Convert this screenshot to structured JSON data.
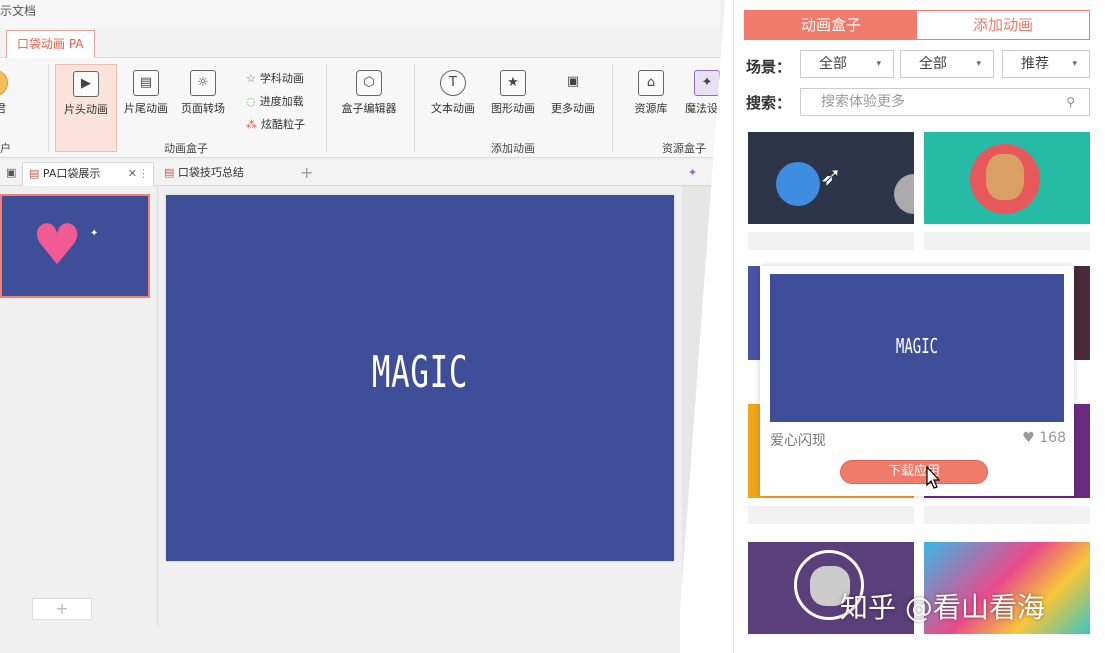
{
  "window": {
    "title": "示文档"
  },
  "ribbon_tab": {
    "label": "口袋动画 PA"
  },
  "ribbon": {
    "left_cut": {
      "label": "袋君",
      "sub": "户"
    },
    "buttons": {
      "intro_anim": "片头动画",
      "outro_anim": "片尾动画",
      "page_transition": "页面转场",
      "box_editor": "盒子编辑器",
      "text_anim": "文本动画",
      "shape_anim": "图形动画",
      "more_anim": "更多动画",
      "resource_lib": "资源库",
      "magic_design": "魔法设计"
    },
    "small": {
      "subject_anim": "学科动画",
      "progress_load": "进度加载",
      "cool_particles": "炫酷粒子"
    },
    "groups": {
      "anim_box": "动画盒子",
      "add_anim": "添加动画",
      "resource_box": "资源盒子"
    }
  },
  "doc_tabs": [
    {
      "label": "PA口袋展示"
    },
    {
      "label": "口袋技巧总结"
    }
  ],
  "slide": {
    "text": "MAGIC"
  },
  "panel": {
    "tabs": {
      "active": "动画盒子",
      "inactive": "添加动画"
    },
    "scene_label": "场景：",
    "filters": [
      "全部",
      "全部",
      "推荐"
    ],
    "search_label": "搜索：",
    "search_placeholder": "搜索体验更多",
    "popup": {
      "name": "爱心闪现",
      "likes": "168",
      "button": "下载应用",
      "preview_text": "MAGIC"
    }
  },
  "watermark": "知乎 @看山看海",
  "colors": {
    "accent": "#f07b6a",
    "slide_bg": "#3f4e98"
  },
  "icons": [
    "search-icon",
    "heart-icon",
    "close-icon",
    "plus-icon",
    "rocket-icon",
    "deer-icon",
    "cat-icon"
  ]
}
